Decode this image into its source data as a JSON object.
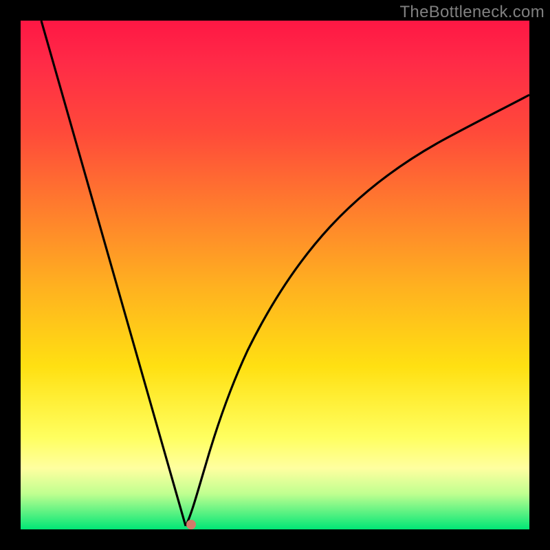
{
  "attribution": "TheBottleneck.com",
  "colors": {
    "frame": "#000000",
    "gradient_top": "#ff1744",
    "gradient_mid": "#ffe012",
    "gradient_bottom": "#00e676",
    "curve": "#000000",
    "marker": "#d37a6a"
  },
  "chart_data": {
    "type": "line",
    "title": "",
    "xlabel": "",
    "ylabel": "",
    "xlim": [
      0,
      100
    ],
    "ylim": [
      0,
      100
    ],
    "series": [
      {
        "name": "left-branch",
        "x": [
          4,
          8,
          12,
          16,
          20,
          24,
          27,
          29,
          31,
          32.5
        ],
        "y": [
          100,
          86,
          72,
          58,
          44,
          30,
          18,
          10,
          4,
          0
        ]
      },
      {
        "name": "right-branch",
        "x": [
          32.5,
          34,
          36,
          39,
          43,
          48,
          55,
          63,
          72,
          82,
          92,
          100
        ],
        "y": [
          0,
          6,
          15,
          26,
          38,
          49,
          59,
          67,
          74,
          79,
          83,
          86
        ]
      }
    ],
    "annotations": [
      {
        "name": "minimum-marker",
        "x": 33.5,
        "y": 1
      }
    ],
    "grid": false,
    "legend": false
  }
}
